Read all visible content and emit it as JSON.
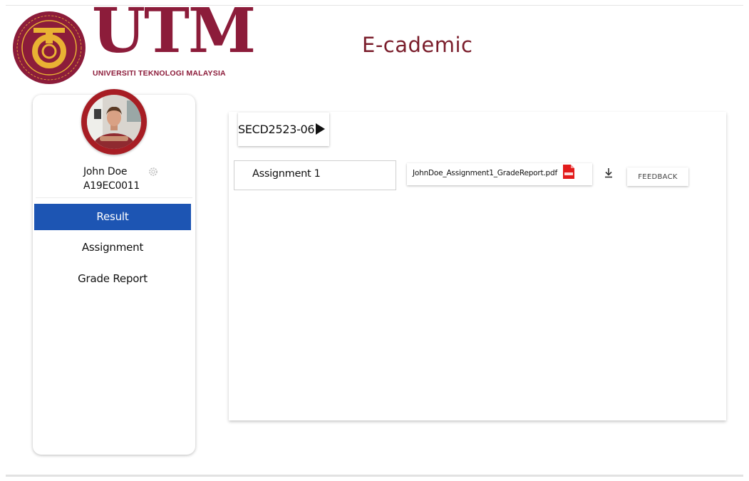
{
  "header": {
    "logo_letters": "UTM",
    "logo_subtitle": "UNIVERSITI TEKNOLOGI MALAYSIA",
    "app_title": "E-cademic"
  },
  "user": {
    "name": "John Doe",
    "id": "A19EC0011"
  },
  "sidebar": {
    "items": [
      {
        "label": "Result",
        "active": true
      },
      {
        "label": "Assignment",
        "active": false
      },
      {
        "label": "Grade Report",
        "active": false
      }
    ]
  },
  "main": {
    "course_code": "SECD2523-06",
    "assignment_label": "Assignment 1",
    "file_name": "JohnDoe_Assignment1_GradeReport.pdf",
    "feedback_label": "FEEDBACK"
  },
  "colors": {
    "brand": "#8c1c3a",
    "title": "#7a1d2b",
    "active_nav": "#1d55b3",
    "avatar_ring": "#a71d24",
    "pdf": "#e21b1b"
  },
  "icons": [
    "university-seal",
    "gear-icon",
    "play-icon",
    "pdf-icon",
    "download-icon"
  ]
}
